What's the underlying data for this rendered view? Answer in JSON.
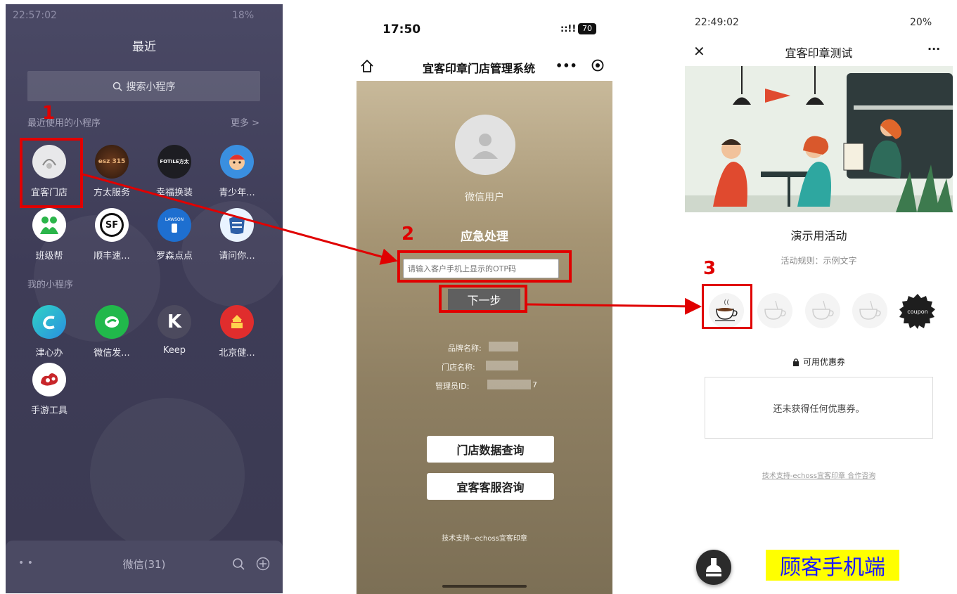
{
  "panel1": {
    "status_time": "22:57:02",
    "status_right": "18%",
    "title": "最近",
    "search_placeholder": "搜索小程序",
    "recent_header": "最近使用的小程序",
    "more_label": "更多 >",
    "recent_apps": [
      {
        "label": "宜客门店",
        "icon": "yike-store-icon",
        "text": ""
      },
      {
        "label": "方太服务",
        "icon": "fangtai-service-icon",
        "text": "esz 315"
      },
      {
        "label": "幸福换装",
        "icon": "fotile-icon",
        "text": "FOTILE方太"
      },
      {
        "label": "青少年...",
        "icon": "youth-mascot-icon",
        "text": ""
      },
      {
        "label": "班级帮",
        "icon": "class-helper-icon",
        "text": ""
      },
      {
        "label": "顺丰速...",
        "icon": "sf-express-icon",
        "text": "SF"
      },
      {
        "label": "罗森点点",
        "icon": "lawson-icon",
        "text": "LAWSON"
      },
      {
        "label": "请问你...",
        "icon": "question-app-icon",
        "text": ""
      }
    ],
    "my_header": "我的小程序",
    "my_apps": [
      {
        "label": "津心办",
        "icon": "jinxinban-icon",
        "text": ""
      },
      {
        "label": "微信发...",
        "icon": "wechat-invoice-icon",
        "text": ""
      },
      {
        "label": "Keep",
        "icon": "keep-icon",
        "text": "K"
      },
      {
        "label": "北京健...",
        "icon": "beijing-health-icon",
        "text": ""
      },
      {
        "label": "手游工具",
        "icon": "game-tools-icon",
        "text": ""
      }
    ],
    "bottom_label": "微信(31)",
    "step_number": "1"
  },
  "panel2": {
    "status_time": "17:50",
    "battery": "70",
    "nav_title": "宜客印章门店管理系统",
    "user_name": "微信用户",
    "section_title": "应急处理",
    "otp_placeholder": "请输入客户手机上显示的OTP码",
    "next_button": "下一步",
    "brand_label": "品牌名称:",
    "store_label": "门店名称:",
    "admin_label": "管理员ID:",
    "admin_suffix": "7",
    "store_data_button": "门店数据查询",
    "service_button": "宜客客服咨询",
    "footer": "技术支持--echoss宜客印章",
    "step_number": "2"
  },
  "panel3": {
    "status_time": "22:49:02",
    "status_right": "20%",
    "nav_title": "宜客印章测试",
    "activity_title": "演示用活动",
    "activity_rules": "活动规则：示例文字",
    "coupon_stamp": "coupon",
    "coupons_header": "可用优惠券",
    "coupons_empty": "还未获得任何优惠券。",
    "footer_link": "技术支持-echoss宜客印章 合作咨询",
    "caption": "顾客手机端",
    "step_number": "3"
  },
  "colors": {
    "annotation_red": "#e00000",
    "highlight_yellow": "#ffff00"
  }
}
